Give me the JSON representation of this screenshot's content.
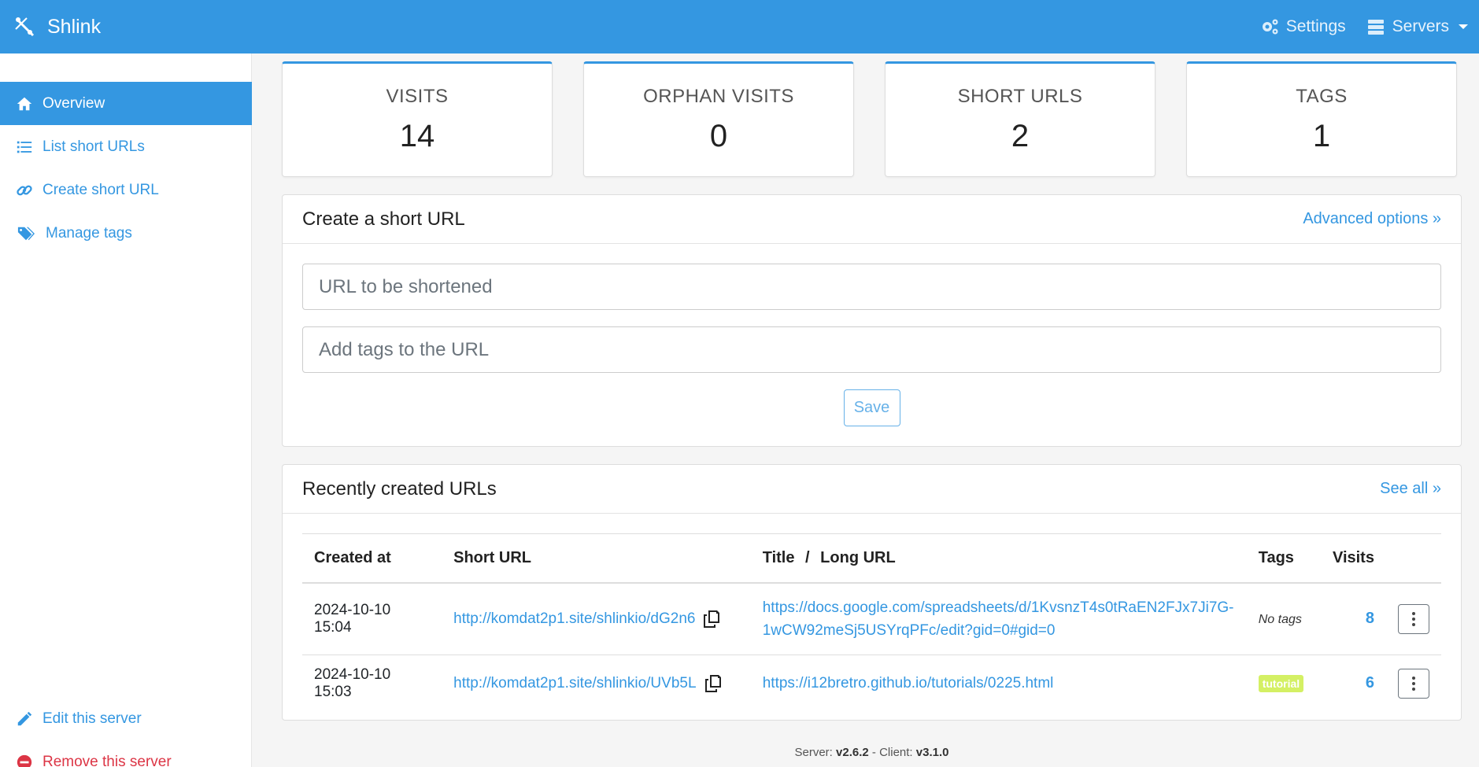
{
  "header": {
    "brand": "Shlink",
    "settings_label": "Settings",
    "servers_label": "Servers"
  },
  "sidebar": {
    "items": [
      {
        "label": "Overview",
        "icon": "home-icon",
        "active": true
      },
      {
        "label": "List short URLs",
        "icon": "list-icon"
      },
      {
        "label": "Create short URL",
        "icon": "link-icon"
      },
      {
        "label": "Manage tags",
        "icon": "tags-icon"
      }
    ],
    "edit_server": "Edit this server",
    "remove_server": "Remove this server"
  },
  "stats": {
    "visits_label": "VISITS",
    "visits_value": "14",
    "orphan_label": "ORPHAN VISITS",
    "orphan_value": "0",
    "short_urls_label": "SHORT URLS",
    "short_urls_value": "2",
    "tags_label": "TAGS",
    "tags_value": "1"
  },
  "create": {
    "title": "Create a short URL",
    "advanced": "Advanced options »",
    "url_placeholder": "URL to be shortened",
    "tags_placeholder": "Add tags to the URL",
    "save": "Save"
  },
  "recent": {
    "title": "Recently created URLs",
    "see_all": "See all »",
    "columns": {
      "created": "Created at",
      "short": "Short URL",
      "title": "Title",
      "sep": "/",
      "long": "Long URL",
      "tags": "Tags",
      "visits": "Visits"
    },
    "rows": [
      {
        "created": "2024-10-10 15:04",
        "short": "http://komdat2p1.site/shlinkio/dG2n6",
        "long": "https://docs.google.com/spreadsheets/d/1KvsnzT4s0tRaEN2FJx7Ji7G-1wCW92meSj5USYrqPFc/edit?gid=0#gid=0",
        "tags": "No tags",
        "visits": "8"
      },
      {
        "created": "2024-10-10 15:03",
        "short": "http://komdat2p1.site/shlinkio/UVb5L",
        "long": "https://i12bretro.github.io/tutorials/0225.html",
        "tags": "tutorial",
        "visits": "6"
      }
    ]
  },
  "footer": {
    "server_label": "Server:",
    "server_version": "v2.6.2",
    "sep": "-",
    "client_label": "Client:",
    "client_version": "v3.1.0"
  },
  "colors": {
    "primary": "#3497e1",
    "danger": "#dc3545",
    "tag": "#d4f064"
  }
}
